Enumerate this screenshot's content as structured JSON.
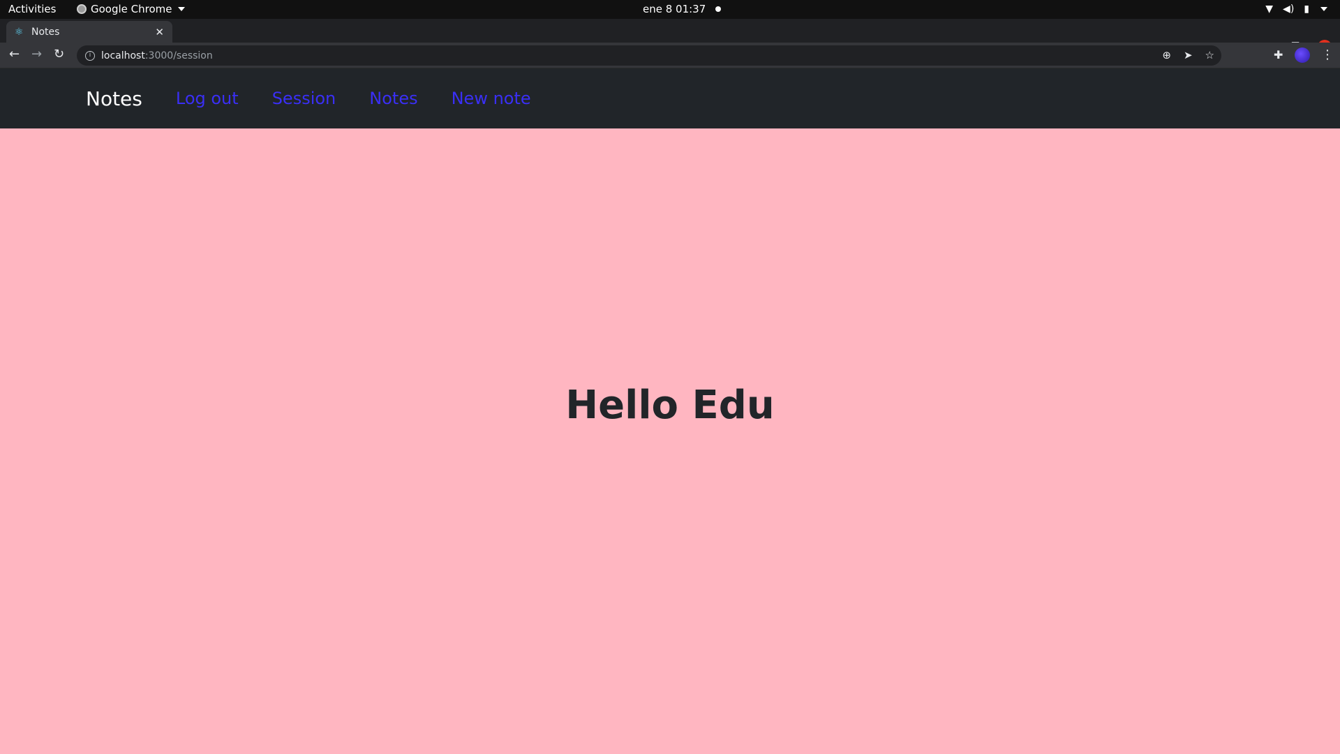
{
  "os_bar": {
    "activities_label": "Activities",
    "app_name": "Google Chrome",
    "clock": "ene 8  01:37"
  },
  "browser": {
    "tab_title": "Notes",
    "url_host": "localhost",
    "url_path": ":3000/session",
    "icons": [
      "back-icon",
      "forward-icon",
      "reload-icon",
      "info-icon",
      "zoom-icon",
      "send-icon",
      "star-icon",
      "extensions-icon",
      "profile-avatar",
      "menu-icon"
    ]
  },
  "app_nav": {
    "brand": "Notes",
    "links": [
      "Log out",
      "Session",
      "Notes",
      "New note"
    ],
    "link_color": "#3a2ff5",
    "background": "#212529"
  },
  "main": {
    "greeting": "Hello Edu",
    "background": "#ffb6c1"
  }
}
